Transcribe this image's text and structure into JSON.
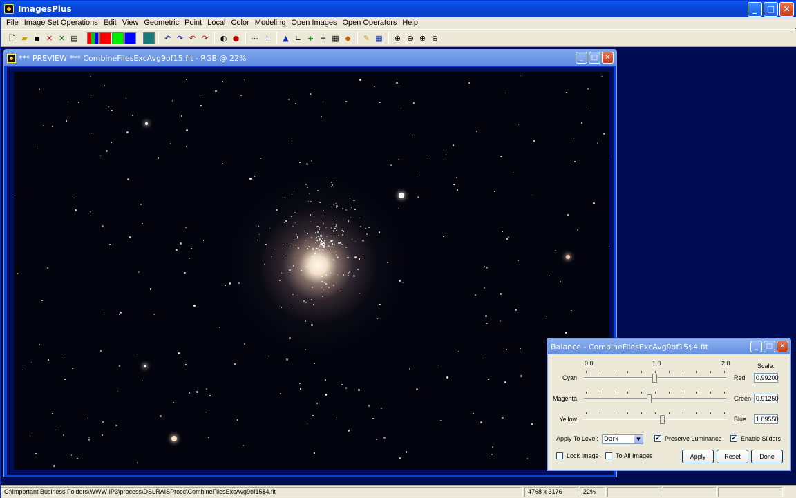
{
  "window": {
    "title": "ImagesPlus"
  },
  "menu": [
    "File",
    "Image Set Operations",
    "Edit",
    "View",
    "Geometric",
    "Point",
    "Local",
    "Color",
    "Modeling",
    "Open Images",
    "Open Operators",
    "Help"
  ],
  "preview": {
    "title": "*** PREVIEW *** CombineFilesExcAvg9of15.fit - RGB @ 22%"
  },
  "balance": {
    "title": "Balance - CombineFilesExcAvg9of15$4.fit",
    "scale_marks": [
      "0.0",
      "1.0",
      "2.0"
    ],
    "scale_label": "Scale:",
    "rows": [
      {
        "left": "Cyan",
        "right": "Red",
        "value": "0.99200",
        "level": 0.496
      },
      {
        "left": "Magenta",
        "right": "Green",
        "value": "0.91250",
        "level": 0.456
      },
      {
        "left": "Yellow",
        "right": "Blue",
        "value": "1.09550",
        "level": 0.548
      }
    ],
    "apply_level_label": "Apply To Level:",
    "apply_level_value": "Dark",
    "preserve_label": "Preserve Luminance",
    "enable_label": "Enable Sliders",
    "lock_label": "Lock Image",
    "all_label": "To All Images",
    "apply_btn": "Apply",
    "reset_btn": "Reset",
    "done_btn": "Done"
  },
  "status": {
    "path": "C:\\Important Business Folders\\WWW IP3\\process\\DSLRAISProcc\\CombineFilesExcAvg9of15$4.fit",
    "dims": "4768 x 3176",
    "zoom": "22%"
  },
  "colors": {
    "red": "#ff0000",
    "green": "#00e000",
    "blue": "#0000ff",
    "mdi": "#000c52"
  }
}
